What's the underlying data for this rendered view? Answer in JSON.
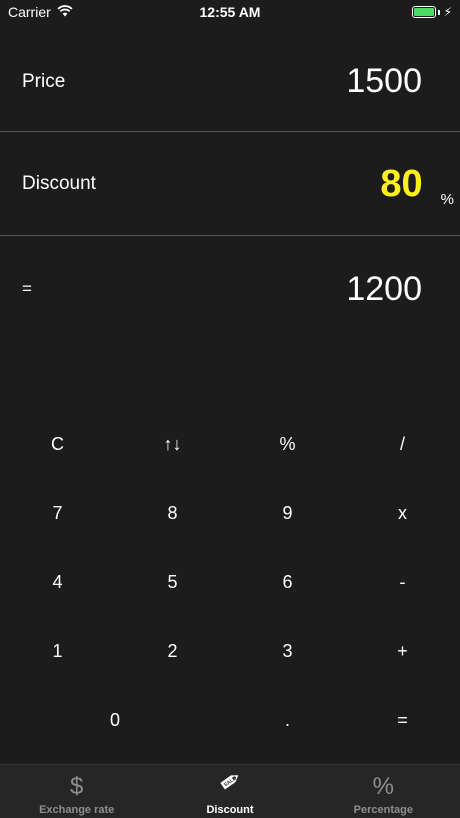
{
  "status_bar": {
    "carrier": "Carrier",
    "time": "12:55 AM",
    "battery_color": "#4cd964"
  },
  "price": {
    "label": "Price",
    "value": "1500"
  },
  "discount": {
    "label": "Discount",
    "value": "80",
    "unit": "%",
    "value_color": "#ffef1a"
  },
  "result": {
    "label": "=",
    "value": "1200"
  },
  "keypad": {
    "keys": [
      "C",
      "↑↓",
      "%",
      "/",
      "7",
      "8",
      "9",
      "x",
      "4",
      "5",
      "6",
      "-",
      "1",
      "2",
      "3",
      "+",
      "0",
      ".",
      "="
    ]
  },
  "tabs": [
    {
      "label": "Exchange rate",
      "icon": "dollar-icon",
      "glyph": "$",
      "active": false
    },
    {
      "label": "Discount",
      "icon": "sale-tag-icon",
      "glyph": "🏷",
      "active": true
    },
    {
      "label": "Percentage",
      "icon": "percent-icon",
      "glyph": "%",
      "active": false
    }
  ]
}
